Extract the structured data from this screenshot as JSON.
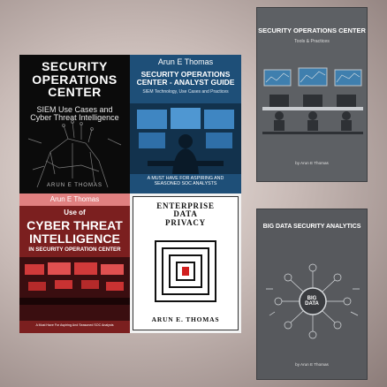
{
  "books": [
    {
      "title_lines": [
        "SECURITY",
        "OPERATIONS",
        "CENTER"
      ],
      "subtitle_lines": [
        "SIEM Use Cases and",
        "Cyber Threat Intelligence"
      ],
      "author": "ARUN E THOMAS"
    },
    {
      "author": "Arun E Thomas",
      "title_lines": [
        "SECURITY OPERATIONS",
        "CENTER - ANALYST GUIDE"
      ],
      "subtitle": "SIEM Technology, Use Cases and Practices",
      "tagline_lines": [
        "A MUST HAVE FOR ASPIRING AND",
        "SEASONED SOC ANALYSTS"
      ]
    },
    {
      "author": "Arun E Thomas",
      "pre_title": "Use of",
      "title_lines": [
        "CYBER THREAT",
        "INTELLIGENCE"
      ],
      "subtitle": "IN SECURITY OPERATION CENTER",
      "tagline": "A Must Have For Aspiring And Seasoned SOC Analysts"
    },
    {
      "title_lines": [
        "ENTERPRISE",
        "DATA",
        "PRIVACY"
      ],
      "author": "ARUN E. THOMAS"
    },
    {
      "title": "SECURITY OPERATIONS CENTER",
      "subtitle": "Tools & Practices",
      "author": "by Arun E Thomas"
    },
    {
      "title": "BIG DATA SECURITY ANALYTICS",
      "center_label_lines": [
        "BIG",
        "DATA"
      ],
      "author": "by Arun E Thomas"
    }
  ],
  "colors": {
    "cover2_bg": "#1e4f78",
    "cover3_bg": "#7b1f1f",
    "cover3_top": "#e08080",
    "accent_red": "#d11f1f"
  }
}
